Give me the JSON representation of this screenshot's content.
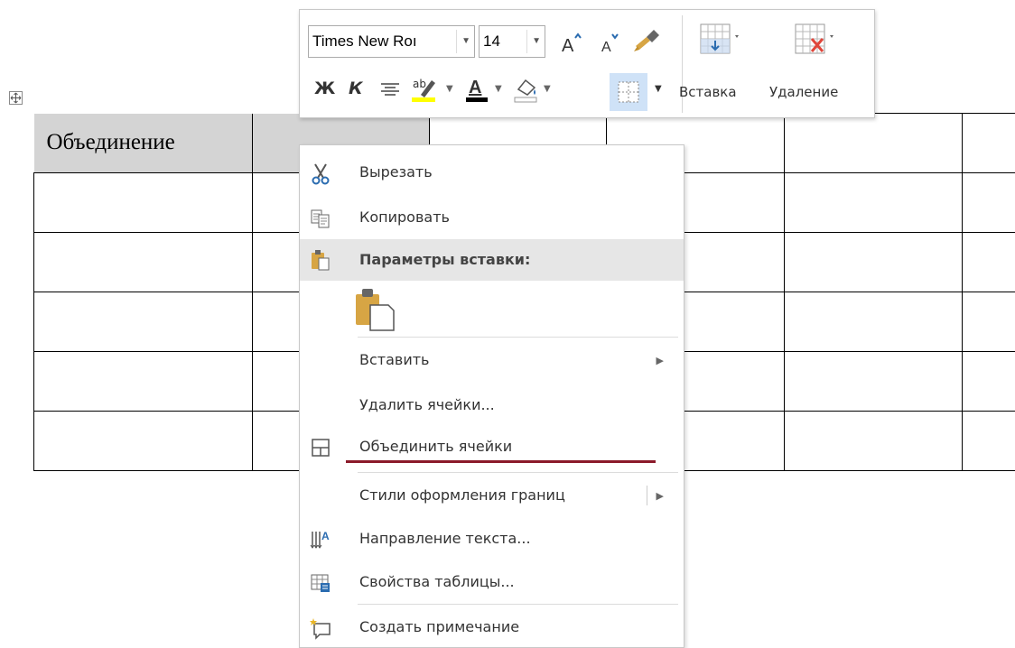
{
  "table": {
    "merged_cell_text": "Объединение"
  },
  "toolbar": {
    "font_name": "Times New Roı",
    "font_size": "14",
    "bold_label": "Ж",
    "italic_label": "К",
    "insert_label": "Вставка",
    "delete_label": "Удаление",
    "highlight_color": "#ffff00",
    "font_color": "#000000",
    "icons": [
      "grow-font-icon",
      "shrink-font-icon",
      "format-painter-icon",
      "insert-table-icon",
      "delete-table-icon",
      "align-icon",
      "highlight-icon",
      "font-color-icon",
      "shading-icon",
      "borders-icon"
    ]
  },
  "context_menu": {
    "cut": "Вырезать",
    "copy": "Копировать",
    "paste_options": "Параметры вставки:",
    "insert": "Вставить",
    "delete_cells": "Удалить ячейки...",
    "merge_cells": "Объединить ячейки",
    "border_styles": "Стили оформления границ",
    "text_direction": "Направление текста...",
    "table_properties": "Свойства таблицы...",
    "new_comment": "Создать примечание",
    "accent_color": "#8b1a2a"
  }
}
